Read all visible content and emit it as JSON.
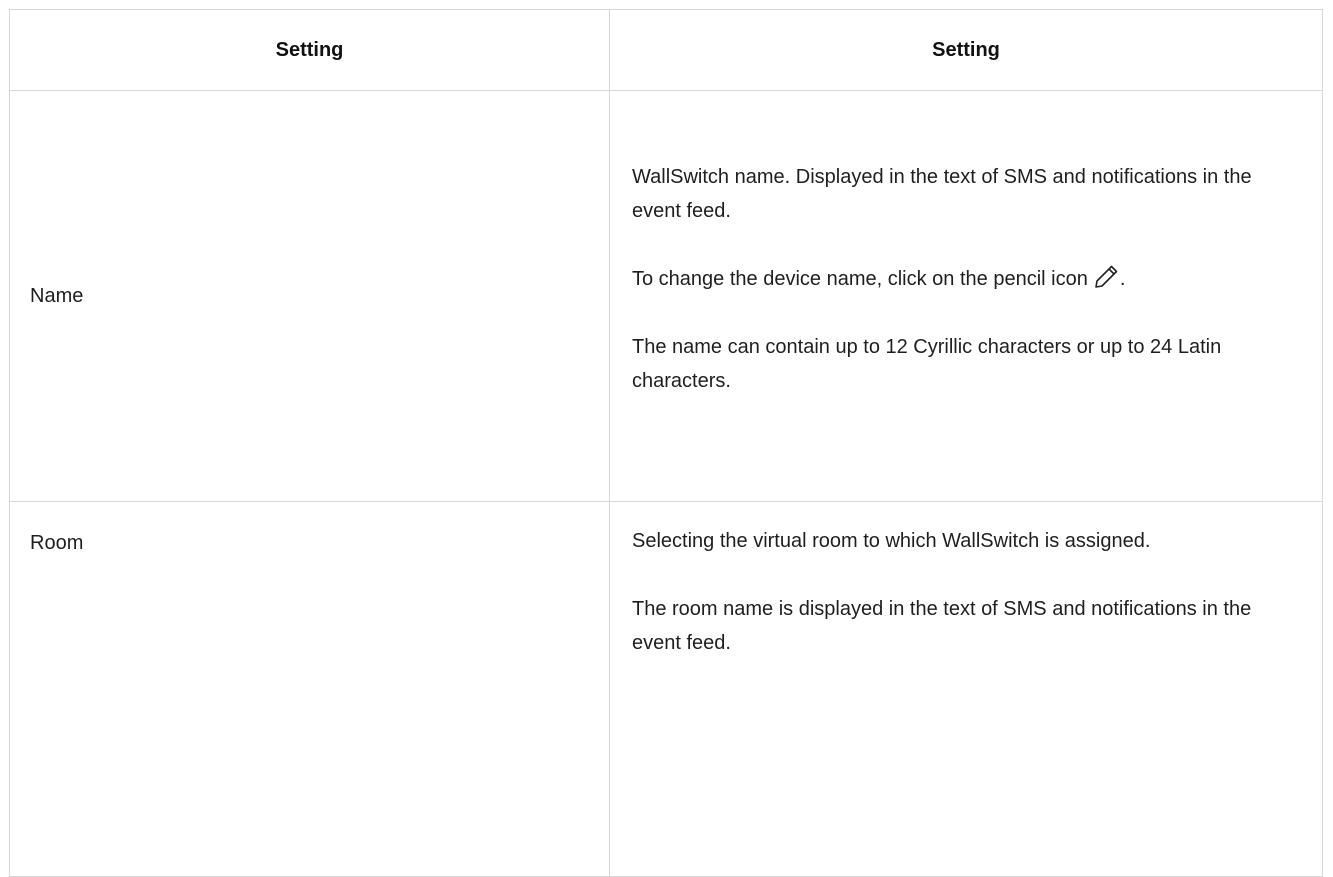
{
  "table": {
    "headers": [
      "Setting",
      "Setting"
    ],
    "rows": [
      {
        "label": "Name",
        "paragraphs": [
          "WallSwitch name. Displayed in the text of SMS and notifications in the event feed.",
          "To change the device name, click on the pencil icon",
          "The name can contain up to 12 Cyrillic characters or up to 24 Latin characters."
        ],
        "icon_after_paragraph_2": "pencil-icon",
        "icon_suffix": "."
      },
      {
        "label": "Room",
        "paragraphs": [
          "Selecting the virtual room to which WallSwitch is assigned.",
          "The room name is displayed in the text of SMS and notifications in the event feed."
        ]
      }
    ]
  },
  "colors": {
    "border": "#d7d7d7",
    "text": "#1f1f1f",
    "background": "#ffffff"
  }
}
